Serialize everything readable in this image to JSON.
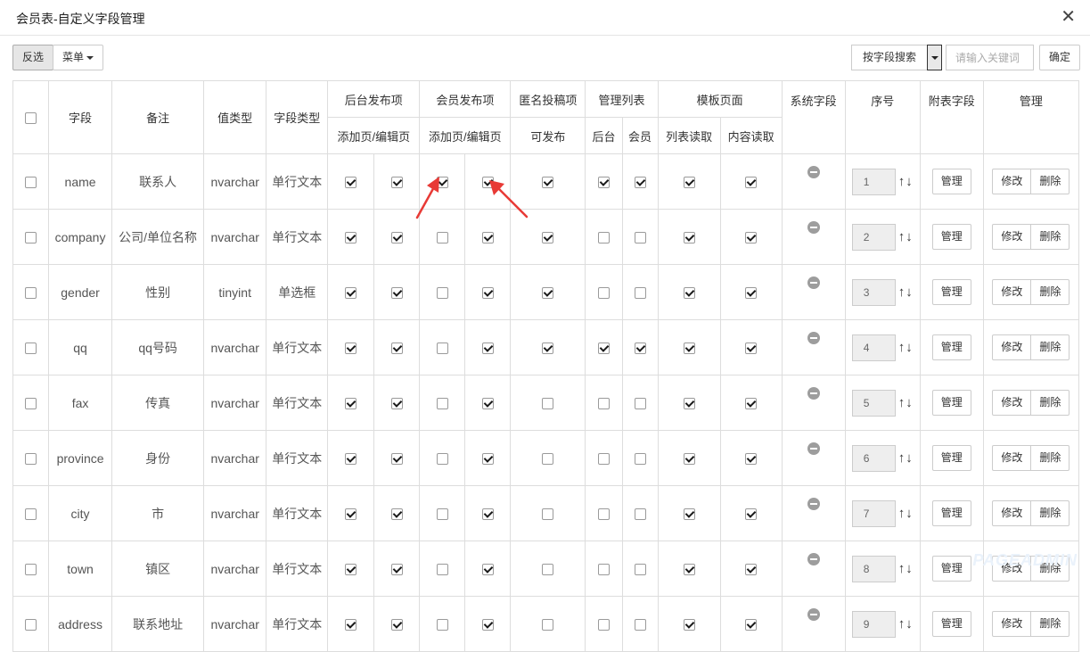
{
  "window": {
    "title": "会员表-自定义字段管理",
    "close_icon": "close-icon"
  },
  "toolbar": {
    "invert_label": "反选",
    "menu_label": "菜单",
    "search_field_label": "按字段搜索",
    "search_placeholder": "请输入关键词",
    "confirm_label": "确定"
  },
  "table": {
    "headers": {
      "field": "字段",
      "note": "备注",
      "value_type": "值类型",
      "field_type": "字段类型",
      "backend_publish": "后台发布项",
      "member_publish": "会员发布项",
      "anon_submit": "匿名投稿项",
      "manage_list": "管理列表",
      "template_page": "模板页面",
      "system_field": "系统字段",
      "order": "序号",
      "sub_field": "附表字段",
      "manage": "管理"
    },
    "subheaders": {
      "backend_add_edit": "添加页/编辑页",
      "member_add_edit": "添加页/编辑页",
      "anon_can_publish": "可发布",
      "list_backend": "后台",
      "list_member": "会员",
      "tpl_list_read": "列表读取",
      "tpl_content_read": "内容读取"
    },
    "actions": {
      "manage": "管理",
      "edit": "修改",
      "delete": "删除"
    },
    "rows": [
      {
        "field": "name",
        "note": "联系人",
        "value_type": "nvarchar",
        "field_type": "单行文本",
        "backend_add": true,
        "backend_edit": true,
        "member_add": true,
        "member_edit": true,
        "anon": true,
        "list_backend": true,
        "list_member": true,
        "tpl_list": true,
        "tpl_content": true,
        "order": "1"
      },
      {
        "field": "company",
        "note": "公司/单位名称",
        "value_type": "nvarchar",
        "field_type": "单行文本",
        "backend_add": true,
        "backend_edit": true,
        "member_add": false,
        "member_edit": true,
        "anon": true,
        "list_backend": false,
        "list_member": false,
        "tpl_list": true,
        "tpl_content": true,
        "order": "2"
      },
      {
        "field": "gender",
        "note": "性别",
        "value_type": "tinyint",
        "field_type": "单选框",
        "backend_add": true,
        "backend_edit": true,
        "member_add": false,
        "member_edit": true,
        "anon": true,
        "list_backend": false,
        "list_member": false,
        "tpl_list": true,
        "tpl_content": true,
        "order": "3"
      },
      {
        "field": "qq",
        "note": "qq号码",
        "value_type": "nvarchar",
        "field_type": "单行文本",
        "backend_add": true,
        "backend_edit": true,
        "member_add": false,
        "member_edit": true,
        "anon": true,
        "list_backend": true,
        "list_member": true,
        "tpl_list": true,
        "tpl_content": true,
        "order": "4"
      },
      {
        "field": "fax",
        "note": "传真",
        "value_type": "nvarchar",
        "field_type": "单行文本",
        "backend_add": true,
        "backend_edit": true,
        "member_add": false,
        "member_edit": true,
        "anon": false,
        "list_backend": false,
        "list_member": false,
        "tpl_list": true,
        "tpl_content": true,
        "order": "5"
      },
      {
        "field": "province",
        "note": "身份",
        "value_type": "nvarchar",
        "field_type": "单行文本",
        "backend_add": true,
        "backend_edit": true,
        "member_add": false,
        "member_edit": true,
        "anon": false,
        "list_backend": false,
        "list_member": false,
        "tpl_list": true,
        "tpl_content": true,
        "order": "6"
      },
      {
        "field": "city",
        "note": "市",
        "value_type": "nvarchar",
        "field_type": "单行文本",
        "backend_add": true,
        "backend_edit": true,
        "member_add": false,
        "member_edit": true,
        "anon": false,
        "list_backend": false,
        "list_member": false,
        "tpl_list": true,
        "tpl_content": true,
        "order": "7"
      },
      {
        "field": "town",
        "note": "镇区",
        "value_type": "nvarchar",
        "field_type": "单行文本",
        "backend_add": true,
        "backend_edit": true,
        "member_add": false,
        "member_edit": true,
        "anon": false,
        "list_backend": false,
        "list_member": false,
        "tpl_list": true,
        "tpl_content": true,
        "order": "8"
      },
      {
        "field": "address",
        "note": "联系地址",
        "value_type": "nvarchar",
        "field_type": "单行文本",
        "backend_add": true,
        "backend_edit": true,
        "member_add": false,
        "member_edit": true,
        "anon": false,
        "list_backend": false,
        "list_member": false,
        "tpl_list": true,
        "tpl_content": true,
        "order": "9"
      }
    ]
  },
  "annotation_color": "#e83a36",
  "watermark": "PAGEADMIN"
}
